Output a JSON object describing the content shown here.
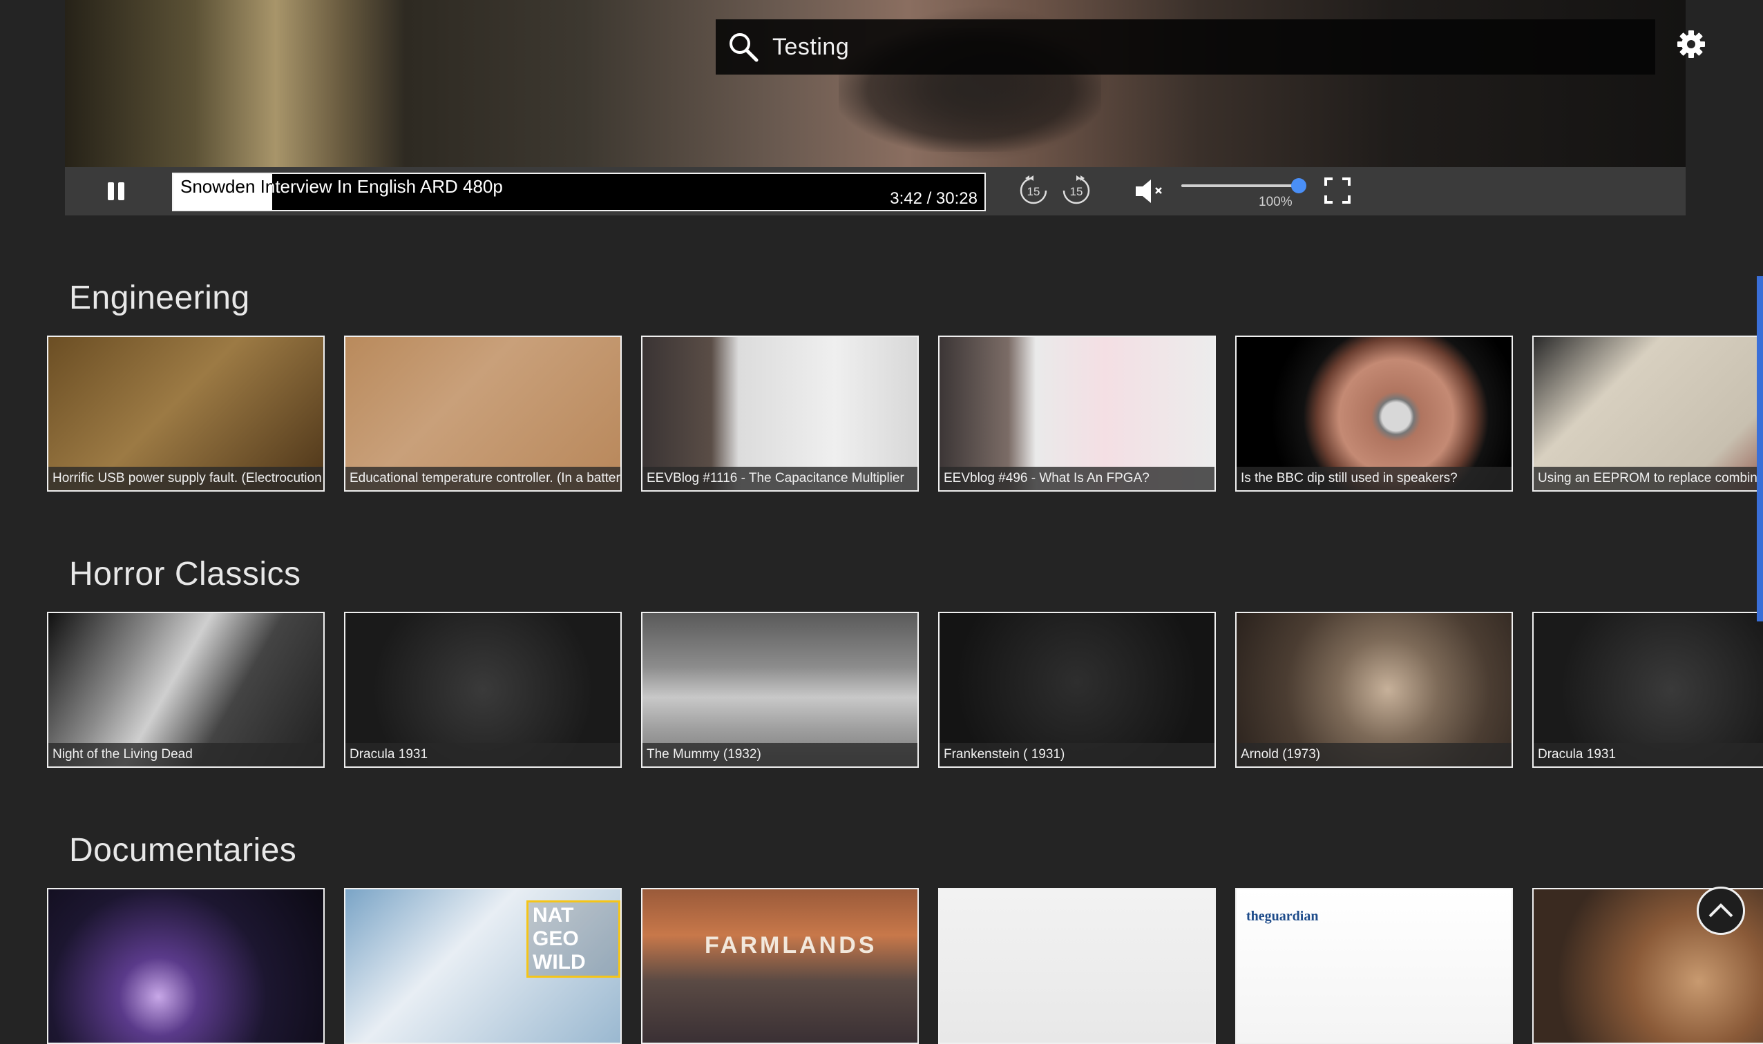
{
  "player": {
    "search_value": "Testing",
    "video_title": "Snowden Interview In English ARD 480p",
    "time_display": "3:42 / 30:28",
    "progress_fraction": 0.1215,
    "rewind_seconds": "15",
    "forward_seconds": "15",
    "volume_label": "100%",
    "volume_fraction": 1.0,
    "muted": true,
    "icons": [
      "search-icon",
      "gear-icon",
      "pause-icon",
      "rewind-15-icon",
      "forward-15-icon",
      "volume-muted-icon",
      "fullscreen-icon"
    ]
  },
  "rows": [
    {
      "title": "Engineering",
      "items": [
        {
          "caption": "Horrific USB power supply fault. (Electrocution hazard)",
          "thumb": "usb"
        },
        {
          "caption": "Educational temperature controller. (In a battery box?)",
          "thumb": "pcb"
        },
        {
          "caption": "EEVBlog #1116 - The Capacitance Multiplier",
          "thumb": "whiteboard"
        },
        {
          "caption": "EEVblog #496 - What Is An FPGA?",
          "thumb": "fpga"
        },
        {
          "caption": "Is the BBC dip still used in speakers?",
          "thumb": "speaker"
        },
        {
          "caption": "Using an EEPROM to replace combinational logic",
          "thumb": "breadboard"
        }
      ]
    },
    {
      "title": "Horror Classics",
      "items": [
        {
          "caption": "Night of the Living Dead",
          "thumb": "bw-car"
        },
        {
          "caption": "Dracula 1931",
          "thumb": "bw-credits"
        },
        {
          "caption": "The Mummy (1932)",
          "thumb": "bw-building"
        },
        {
          "caption": "Frankenstein ( 1931)",
          "thumb": "bw-players"
        },
        {
          "caption": "Arnold (1973)",
          "thumb": "sepia-man"
        },
        {
          "caption": "Dracula 1931",
          "thumb": "bw-credits"
        }
      ]
    },
    {
      "title": "Documentaries",
      "items": [
        {
          "caption": "",
          "thumb": "galaxy"
        },
        {
          "caption": "",
          "thumb": "natgeo",
          "logo_text": "NAT GEO WILD"
        },
        {
          "caption": "",
          "thumb": "farmlands",
          "logo_text": "FARMLANDS"
        },
        {
          "caption": "",
          "thumb": "horsemen"
        },
        {
          "caption": "",
          "thumb": "news",
          "logo_text": "theguardian"
        },
        {
          "caption": "",
          "thumb": "portrait"
        }
      ]
    }
  ],
  "colors": {
    "background": "#242424",
    "control_bar": "#3b3b3b",
    "volume_knob": "#4a8ff7",
    "scrollbar": "#3a6fd8"
  }
}
